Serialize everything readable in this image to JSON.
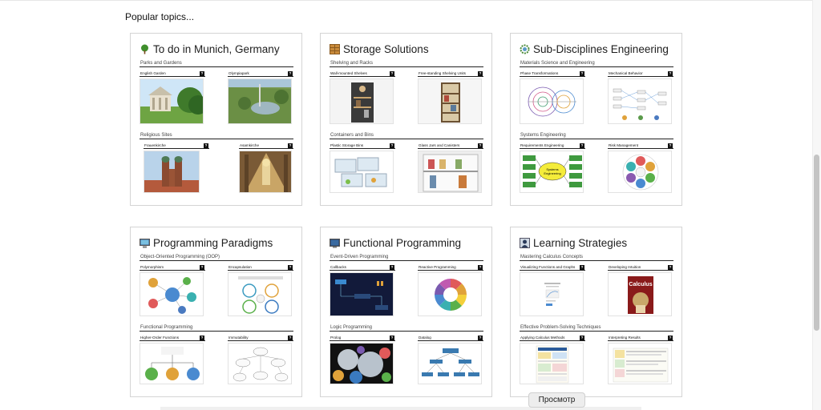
{
  "page": {
    "heading": "Popular topics..."
  },
  "cards": [
    {
      "title": "To do in Munich, Germany",
      "icon": "tree-icon",
      "sections": [
        {
          "title": "Parks and Gardens",
          "items": [
            {
              "label": "English Garden",
              "thumb": "garden-photo"
            },
            {
              "label": "Olympiapark",
              "thumb": "park-photo"
            }
          ]
        },
        {
          "title": "Religious Sites",
          "items": [
            {
              "label": "Frauenkirche",
              "thumb": "cathedral-photo"
            },
            {
              "label": "Asamkirche",
              "thumb": "church-interior-photo"
            }
          ]
        }
      ]
    },
    {
      "title": "Storage Solutions",
      "icon": "shelf-icon",
      "sections": [
        {
          "title": "Shelving and Racks",
          "items": [
            {
              "label": "Wall-mounted Shelves",
              "thumb": "wall-shelves-photo"
            },
            {
              "label": "Free-standing Shelving Units",
              "thumb": "shelving-unit-photo"
            }
          ]
        },
        {
          "title": "Containers and Bins",
          "items": [
            {
              "label": "Plastic Storage Bins",
              "thumb": "bins-photo"
            },
            {
              "label": "Glass Jars and Canisters",
              "thumb": "jars-photo"
            }
          ]
        }
      ]
    },
    {
      "title": "Sub-Disciplines Engineering",
      "icon": "gear-icon",
      "sections": [
        {
          "title": "Materials Science and Engineering",
          "items": [
            {
              "label": "Phase Transformations",
              "thumb": "phase-diagram"
            },
            {
              "label": "Mechanical Behavior",
              "thumb": "behavior-diagram"
            }
          ]
        },
        {
          "title": "Systems Engineering",
          "items": [
            {
              "label": "Requirements Engineering",
              "thumb": "systems-engineering-diagram"
            },
            {
              "label": "Risk Management",
              "thumb": "risk-wheel-diagram"
            }
          ]
        }
      ]
    },
    {
      "title": "Programming Paradigms",
      "icon": "monitor-icon",
      "sections": [
        {
          "title": "Object-Oriented Programming (OOP)",
          "items": [
            {
              "label": "Polymorphism",
              "thumb": "polymorphism-diagram"
            },
            {
              "label": "Encapsulation",
              "thumb": "encapsulation-diagram"
            }
          ]
        },
        {
          "title": "Functional Programming",
          "items": [
            {
              "label": "Higher-Order Functions",
              "thumb": "functions-tree-diagram"
            },
            {
              "label": "Immutability",
              "thumb": "immutability-diagram"
            }
          ]
        }
      ]
    },
    {
      "title": "Functional Programming",
      "icon": "terminal-icon",
      "sections": [
        {
          "title": "Event-Driven Programming",
          "items": [
            {
              "label": "Callbacks",
              "thumb": "callbacks-diagram"
            },
            {
              "label": "Reactive Programming",
              "thumb": "reactive-wheel-diagram"
            }
          ]
        },
        {
          "title": "Logic Programming",
          "items": [
            {
              "label": "Prolog",
              "thumb": "prolog-bubbles"
            },
            {
              "label": "Datalog",
              "thumb": "datalog-tree"
            }
          ]
        }
      ]
    },
    {
      "title": "Learning Strategies",
      "icon": "student-icon",
      "sections": [
        {
          "title": "Mastering Calculus Concepts",
          "items": [
            {
              "label": "Visualizing Functions and Graphs",
              "thumb": "graphs-page"
            },
            {
              "label": "Developing Intuition",
              "thumb": "calculus-book-cover"
            }
          ]
        },
        {
          "title": "Effective Problem-Solving Techniques",
          "items": [
            {
              "label": "Applying Calculus Methods",
              "thumb": "methods-sheet"
            },
            {
              "label": "Interpreting Results",
              "thumb": "results-sheet"
            }
          ]
        }
      ]
    }
  ],
  "calculus_cover_text": "Calculus",
  "ui": {
    "preview_button": "Просмотр",
    "help_mark": "?"
  }
}
